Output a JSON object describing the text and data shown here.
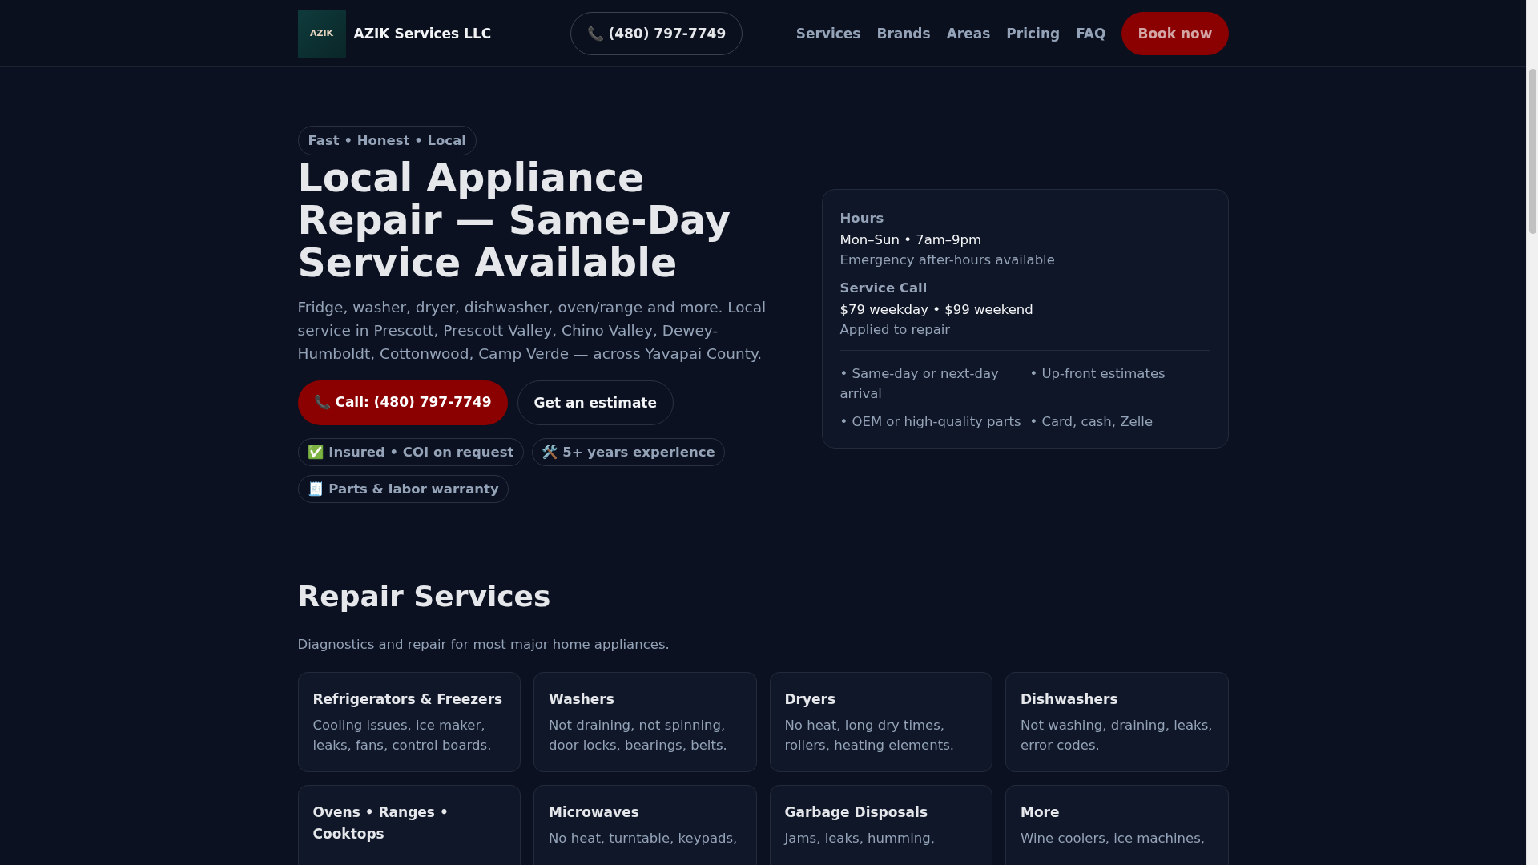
{
  "header": {
    "logo_text": "AZIK",
    "brand": "AZIK Services LLC",
    "phone": {
      "icon": "📞",
      "label": "(480) 797-7749"
    },
    "nav": [
      "Services",
      "Brands",
      "Areas",
      "Pricing",
      "FAQ"
    ],
    "cta": "Book now"
  },
  "hero": {
    "tagline": "Fast • Honest • Local",
    "title": "Local Appliance Repair — Same-Day Service Available",
    "lead": "Fridge, washer, dryer, dishwasher, oven/range and more. Local service in Prescott, Prescott Valley, Chino Valley, Dewey-Humboldt, Cottonwood, Camp Verde — across Yavapai County.",
    "buttons": [
      {
        "kind": "primary",
        "icon": "📞",
        "label": "Call: (480) 797-7749"
      },
      {
        "kind": "secondary",
        "label": "Get an estimate"
      }
    ],
    "badges": [
      {
        "icon": "✅",
        "label": "Insured • COI on request"
      },
      {
        "icon": "🛠️",
        "label": "5+ years experience"
      },
      {
        "icon": "🧾",
        "label": "Parts & labor warranty"
      }
    ]
  },
  "info_card": {
    "sections": [
      {
        "heading": "Hours",
        "value": "Mon–Sun • 7am–9pm",
        "note": "Emergency after-hours available"
      },
      {
        "heading": "Service Call",
        "value": "$79 weekday • $99 weekend",
        "note": "Applied to repair"
      }
    ],
    "features": [
      "• Same-day or next-day arrival",
      "• Up-front estimates",
      "• OEM or high-quality parts",
      "• Card, cash, Zelle"
    ]
  },
  "services": {
    "title": "Repair Services",
    "subtitle": "Diagnostics and repair for most major home appliances.",
    "cards": [
      {
        "title": "Refrigerators & Freezers",
        "description": "Cooling issues, ice maker, leaks, fans, control boards."
      },
      {
        "title": "Washers",
        "description": "Not draining, not spinning, door locks, bearings, belts."
      },
      {
        "title": "Dryers",
        "description": "No heat, long dry times, rollers, heating elements."
      },
      {
        "title": "Dishwashers",
        "description": "Not washing, draining, leaks, error codes."
      },
      {
        "title": "Ovens • Ranges • Cooktops"
      },
      {
        "title": "Microwaves",
        "description": "No heat, turntable, keypads,"
      },
      {
        "title": "Garbage Disposals",
        "description": "Jams, leaks, humming,"
      },
      {
        "title": "More",
        "description": "Wine coolers, ice machines,"
      }
    ]
  }
}
